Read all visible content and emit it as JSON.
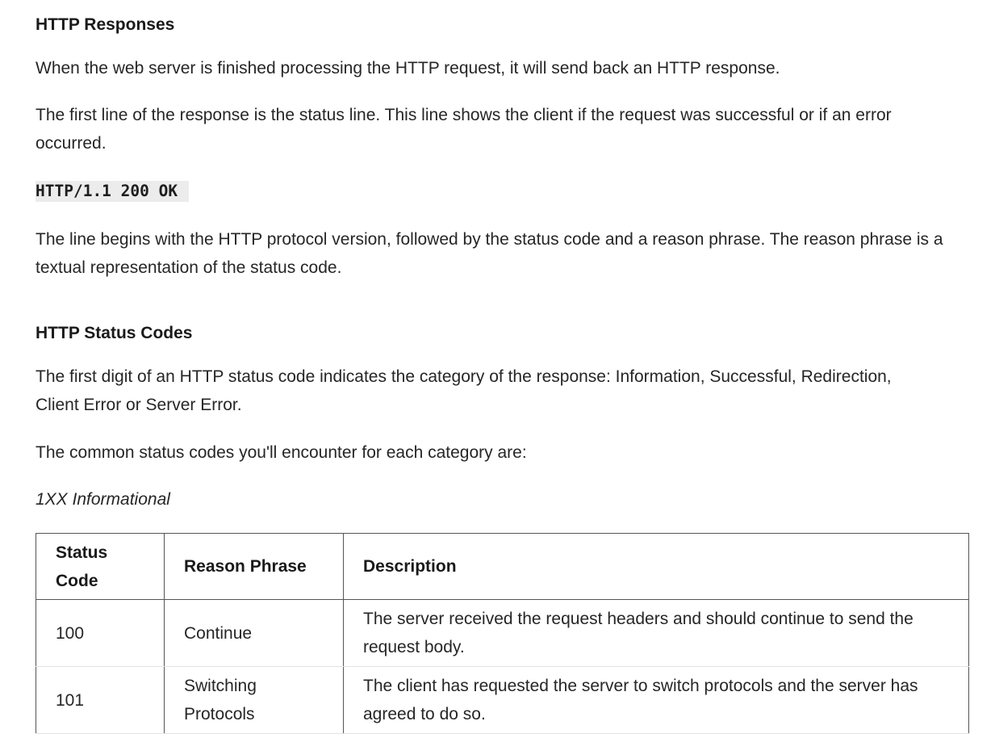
{
  "sections": {
    "responses_heading": "HTTP Responses",
    "responses_p1": "When the web server is finished processing the HTTP request, it will send back an HTTP response.",
    "responses_p2": "The first line of the response is the status line. This line shows the client if the request was successful or if an error occurred.",
    "status_line_code": "HTTP/1.1 200 OK",
    "responses_p3": "The line begins with the HTTP protocol version, followed by the status code and a reason phrase. The reason phrase is a textual representation of the status code.",
    "status_heading": "HTTP Status Codes",
    "status_p1": "The first digit of an HTTP status code indicates the category of the response: Information, Successful, Redirection, Client Error or Server Error.",
    "status_p2": "The common status codes you'll encounter for each category are:",
    "category_label": "1XX Informational"
  },
  "table": {
    "headers": [
      "Status Code",
      "Reason Phrase",
      "Description"
    ],
    "rows": [
      {
        "code": "100",
        "phrase": "Continue",
        "description": "The server received the request headers and should continue to send the request body."
      },
      {
        "code": "101",
        "phrase": "Switching Protocols",
        "description": "The client has requested the server to switch protocols and the server has agreed to do so."
      }
    ]
  }
}
